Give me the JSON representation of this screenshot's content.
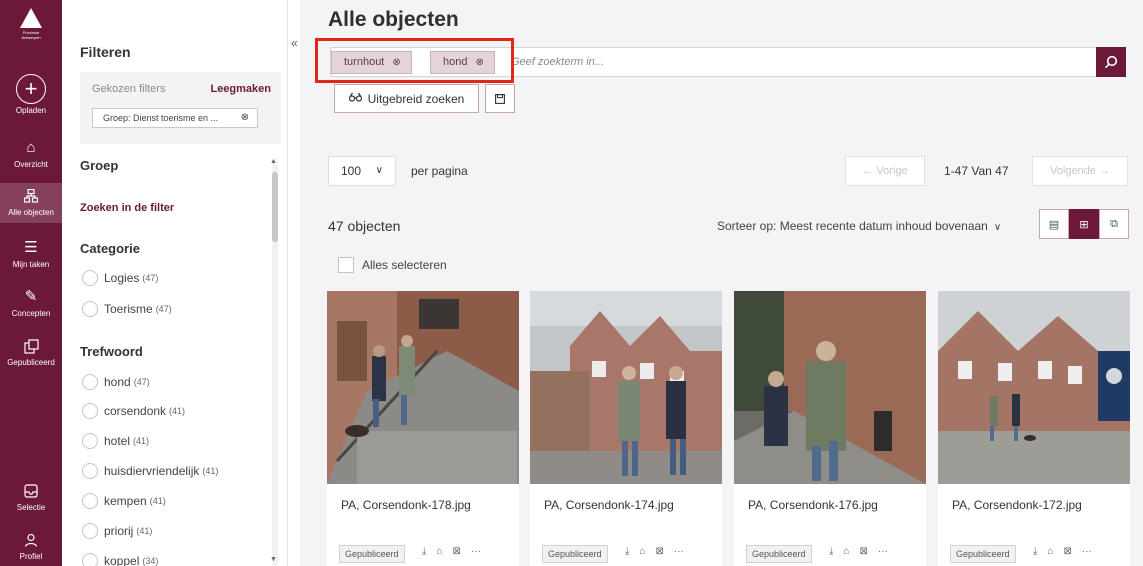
{
  "logo_text": "Provincie Antwerpen",
  "rail": [
    {
      "key": "upload",
      "label": "Opladen",
      "icon": "upload-plus-icon"
    },
    {
      "key": "overview",
      "label": "Overzicht",
      "icon": "home-icon"
    },
    {
      "key": "all_objects",
      "label": "Alle objecten",
      "icon": "grid-tree-icon"
    },
    {
      "key": "tasks",
      "label": "Mijn taken",
      "icon": "task-list-icon"
    },
    {
      "key": "concepts",
      "label": "Concepten",
      "icon": "pencil-icon"
    },
    {
      "key": "published",
      "label": "Gepubliceerd",
      "icon": "published-icon"
    },
    {
      "key": "selection",
      "label": "Selectie",
      "icon": "selection-tray-icon"
    },
    {
      "key": "profile",
      "label": "Profiel",
      "icon": "user-icon"
    }
  ],
  "filters": {
    "title": "Filteren",
    "chosen_label": "Gekozen filters",
    "clear_label": "Leegmaken",
    "chosen_chip": "Groep: Dienst toerisme en ...",
    "group_title": "Groep",
    "search_in_filter": "Zoeken in de filter",
    "category_title": "Categorie",
    "categories": [
      {
        "label": "Logies",
        "count": "(47)"
      },
      {
        "label": "Toerisme",
        "count": "(47)"
      }
    ],
    "keyword_title": "Trefwoord",
    "keywords": [
      {
        "label": "hond",
        "count": "(47)"
      },
      {
        "label": "corsendonk",
        "count": "(41)"
      },
      {
        "label": "hotel",
        "count": "(41)"
      },
      {
        "label": "huisdiervriendelijk",
        "count": "(41)"
      },
      {
        "label": "kempen",
        "count": "(41)"
      },
      {
        "label": "priorij",
        "count": "(41)"
      },
      {
        "label": "koppel",
        "count": "(34)"
      }
    ]
  },
  "main": {
    "title": "Alle objecten",
    "search_placeholder": "Geef zoekterm in...",
    "search_tags": [
      "turnhout",
      "hond"
    ],
    "advanced_search": "Uitgebreid zoeken",
    "per_page_value": "100",
    "per_page_label": "per pagina",
    "prev_label": "← Vorige",
    "pager_info": "1-47 Van 47",
    "next_label": "Volgende →",
    "count_label": "47 objecten",
    "sort_label": "Sorteer op: Meest recente datum inhoud bovenaan",
    "select_all": "Alles selecteren",
    "cards": [
      {
        "filename": "PA, Corsendonk-178.jpg",
        "status": "Gepubliceerd"
      },
      {
        "filename": "PA, Corsendonk-174.jpg",
        "status": "Gepubliceerd"
      },
      {
        "filename": "PA, Corsendonk-176.jpg",
        "status": "Gepubliceerd"
      },
      {
        "filename": "PA, Corsendonk-172.jpg",
        "status": "Gepubliceerd"
      }
    ]
  },
  "colors": {
    "brand": "#6b1839",
    "tag_bg": "#e5d4d7",
    "highlight": "#e1261c"
  }
}
